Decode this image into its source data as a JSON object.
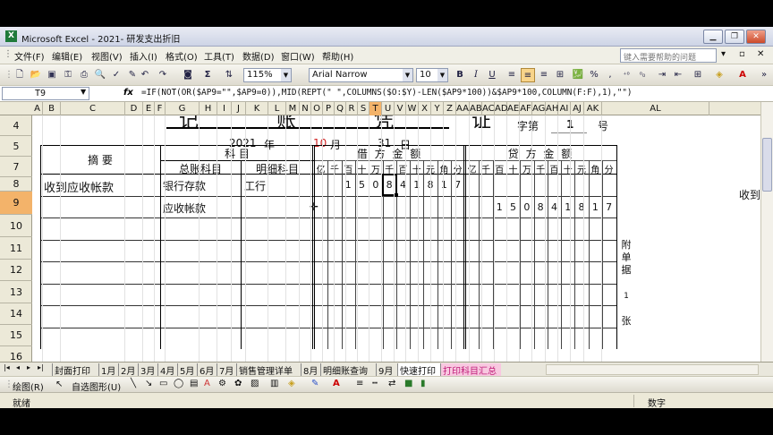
{
  "window": {
    "title": "Microsoft Excel - 2021- 研发支出折旧"
  },
  "menu": [
    "文件(F)",
    "编辑(E)",
    "视图(V)",
    "插入(I)",
    "格式(O)",
    "工具(T)",
    "数据(D)",
    "窗口(W)",
    "帮助(H)"
  ],
  "help_placeholder": "键入需要帮助的问题",
  "toolbar": {
    "zoom": "115%",
    "font": "Arial Narrow",
    "size": "10"
  },
  "formula_bar": {
    "name_box": "T9",
    "fx": "fx",
    "formula": "=IF(NOT(OR($AP9=\"\",$AP9=0)),MID(REPT(\" \",COLUMNS($O:$Y)-LEN($AP9*100))&$AP9*100,COLUMN(F:F),1),\"\")"
  },
  "columns": [
    "A",
    "B",
    "C",
    "D",
    "E",
    "F",
    "G",
    "H",
    "I",
    "J",
    "K",
    "L",
    "M",
    "N",
    "O",
    "P",
    "Q",
    "R",
    "S",
    "T",
    "U",
    "V",
    "W",
    "X",
    "Y",
    "Z",
    "AA",
    "AB",
    "AC",
    "AD",
    "AE",
    "AF",
    "AG",
    "AH",
    "AI",
    "AJ",
    "AK",
    "AL"
  ],
  "rows": [
    "4",
    "5",
    "7",
    "8",
    "9",
    "10",
    "11",
    "12",
    "13",
    "14",
    "15",
    "16"
  ],
  "voucher": {
    "header_partial": "记   账   凭   证",
    "zi_label": "字第",
    "number": "1",
    "hao_label": "号",
    "year": "2021",
    "year_label": "年",
    "month": "10",
    "month_label": "月",
    "day": "31",
    "day_label": "日",
    "summary_header": "摘        要",
    "subject_header": "科        目",
    "general_header": "总账科目",
    "detail_header": "明细科目",
    "debit_header": "借 方 金 额",
    "credit_header": "贷 方 金 额",
    "digit_headers": [
      "亿",
      "千",
      "百",
      "十",
      "万",
      "千",
      "百",
      "十",
      "元",
      "角",
      "分"
    ],
    "rows": [
      {
        "summary": "收到应收帐款",
        "general": "银行存款",
        "detail": "工行",
        "debit": [
          "",
          "",
          "1",
          "5",
          "0",
          "8",
          "4",
          "1",
          "8",
          "1",
          "7"
        ],
        "credit": [
          "",
          "",
          "",
          "",
          "",
          "",
          "",
          "",
          "",
          "",
          ""
        ]
      },
      {
        "summary": "",
        "general": "应收帐款",
        "detail": "",
        "debit": [
          "",
          "",
          "",
          "",
          "",
          "",
          "",
          "",
          "",
          "",
          ""
        ],
        "credit": [
          "",
          "",
          "1",
          "5",
          "0",
          "8",
          "4",
          "1",
          "8",
          "1",
          "7"
        ]
      }
    ],
    "attach": [
      "附",
      "单",
      "据",
      "1",
      "张"
    ],
    "overflow_text": "收到"
  },
  "sheet_tabs": [
    "封面打印",
    "1月",
    "2月",
    "3月",
    "4月",
    "5月",
    "6月",
    "7月",
    "销售管理详单",
    "8月",
    "明细账查询",
    "9月",
    "快速打印",
    "打印科目汇总"
  ],
  "active_tab_index": 13,
  "drawing_toolbar": {
    "draw": "绘图(R)",
    "autoshapes": "自选图形(U)"
  },
  "status": {
    "left": "就绪",
    "right": "数字"
  }
}
